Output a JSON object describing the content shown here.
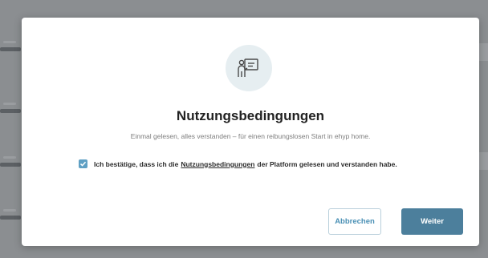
{
  "dialog": {
    "icon": "presentation-user-icon",
    "title": "Nutzungsbedingungen",
    "subtitle": "Einmal gelesen, alles verstanden – für einen reibungslosen Start in ehyp home.",
    "consent": {
      "checked": true,
      "text_before": "Ich bestätige, dass ich die",
      "link": "Nutzungsbedingungen",
      "text_after": "der Platform gelesen und verstanden habe."
    },
    "buttons": {
      "cancel": "Abbrechen",
      "next": "Weiter"
    }
  },
  "colors": {
    "accent": "#4c7f9c",
    "checkbox": "#5fa0c4",
    "icon_bg": "#e6eef1",
    "overlay": "#8b8e91"
  }
}
